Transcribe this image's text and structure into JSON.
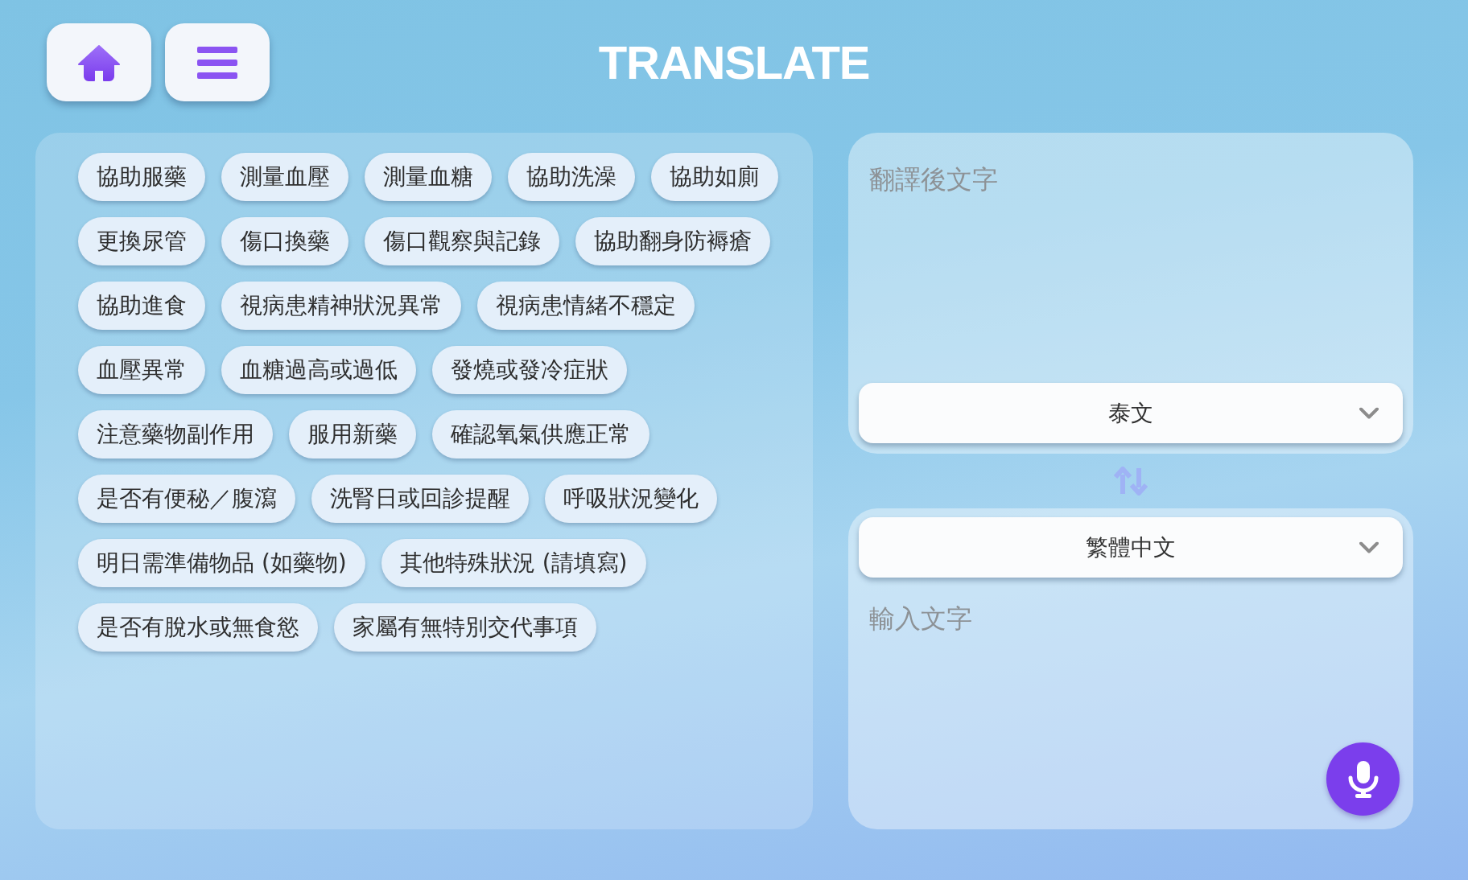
{
  "header": {
    "title": "TRANSLATE"
  },
  "phrases": [
    "協助服藥",
    "測量血壓",
    "測量血糖",
    "協助洗澡",
    "協助如廁",
    "更換尿管",
    "傷口換藥",
    "傷口觀察與記錄",
    "協助翻身防褥瘡",
    "協助進食",
    "視病患精神狀況異常",
    "視病患情緒不穩定",
    "血壓異常",
    "血糖過高或過低",
    "發燒或發冷症狀",
    "注意藥物副作用",
    "服用新藥",
    "確認氧氣供應正常",
    "是否有便秘／腹瀉",
    "洗腎日或回診提醒",
    "呼吸狀況變化",
    "明日需準備物品 (如藥物)",
    "其他特殊狀況 (請填寫)",
    "是否有脫水或無食慾",
    "家屬有無特別交代事項"
  ],
  "output_panel": {
    "placeholder": "翻譯後文字",
    "language": "泰文"
  },
  "input_panel": {
    "language": "繁體中文",
    "placeholder": "輸入文字"
  }
}
